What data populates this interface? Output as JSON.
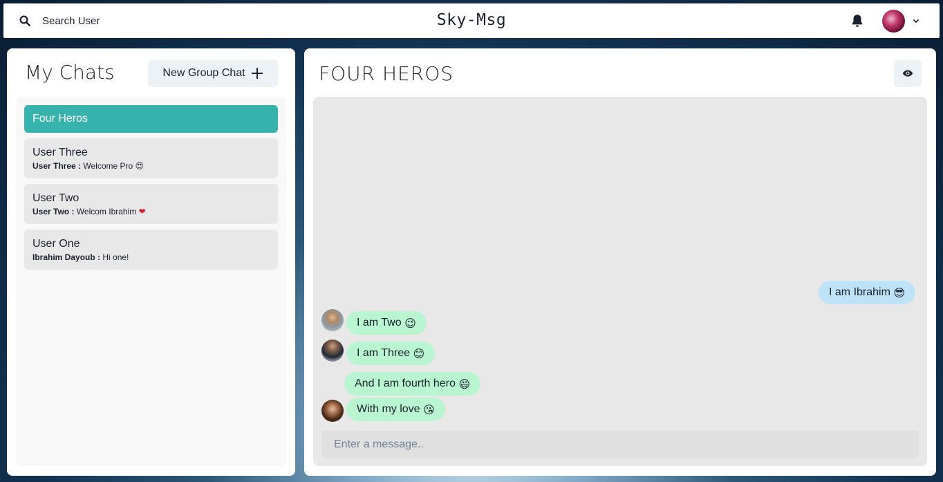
{
  "header": {
    "search_label": "Search User",
    "app_title": "Sky-Msg"
  },
  "sidebar": {
    "title": "My Chats",
    "new_group_label": "New Group Chat",
    "chats": [
      {
        "name": "Four Heros",
        "active": true
      },
      {
        "name": "User Three",
        "sender": "User Three :",
        "message": "Welcome Pro",
        "emoji": "😍"
      },
      {
        "name": "User Two",
        "sender": "User Two :",
        "message": "Welcom Ibrahim",
        "emoji": "❤"
      },
      {
        "name": "User One",
        "sender": "Ibrahim Dayoub :",
        "message": "Hi one!",
        "emoji": ""
      }
    ]
  },
  "chat": {
    "title": "FOUR HEROS",
    "messages": [
      {
        "text": "I am Ibrahim",
        "emoji": "😎",
        "from_me": true
      },
      {
        "text": "I am Two",
        "emoji": "😉",
        "from_me": false
      },
      {
        "text": "I am Three",
        "emoji": "😊",
        "from_me": false
      },
      {
        "text": "And I am fourth hero",
        "emoji": "😄",
        "from_me": false
      },
      {
        "text": "With my love",
        "emoji": "😘",
        "from_me": false
      }
    ],
    "input_placeholder": "Enter a message.."
  },
  "colors": {
    "accent": "#38b2ac",
    "my_bubble": "#bee3f8",
    "their_bubble": "#b9f5d0"
  },
  "icons": [
    "search-icon",
    "bell-icon",
    "chevron-down-icon",
    "plus-icon",
    "eye-icon"
  ]
}
